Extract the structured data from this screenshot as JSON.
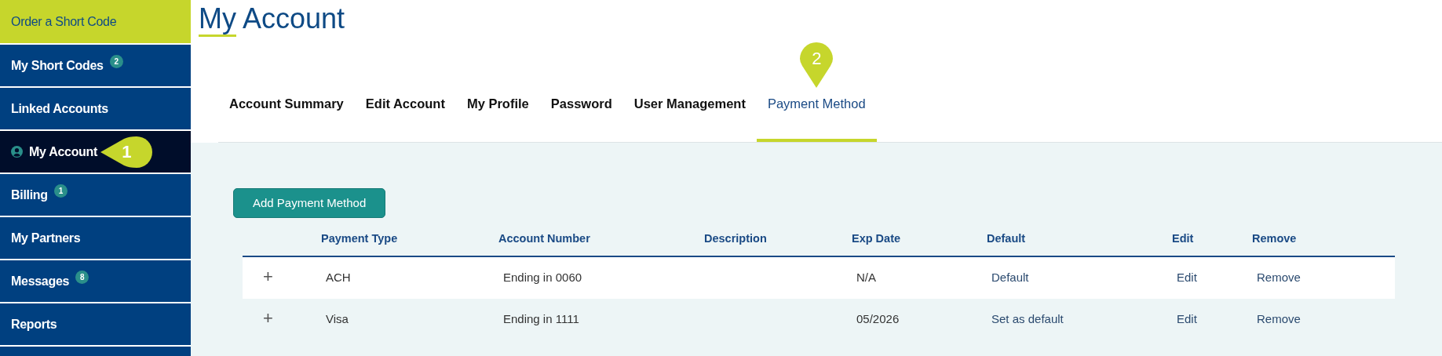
{
  "sidebar": {
    "items": [
      {
        "label": "Order a Short Code",
        "kind": "order",
        "selected": false
      },
      {
        "label": "My Short Codes",
        "badge": "2",
        "kind": "link",
        "selected": false
      },
      {
        "label": "Linked Accounts",
        "kind": "link",
        "selected": false
      },
      {
        "label": "My Account",
        "kind": "account",
        "selected": true,
        "callout": "1"
      },
      {
        "label": "Billing",
        "badge": "1",
        "kind": "link",
        "selected": false
      },
      {
        "label": "My Partners",
        "kind": "link",
        "selected": false
      },
      {
        "label": "Messages",
        "badge": "8",
        "kind": "link",
        "selected": false
      },
      {
        "label": "Reports",
        "kind": "link",
        "selected": false
      }
    ]
  },
  "page_title": "My Account",
  "tabs": [
    {
      "label": "Account Summary",
      "selected": false
    },
    {
      "label": "Edit Account",
      "selected": false
    },
    {
      "label": "My Profile",
      "selected": false
    },
    {
      "label": "Password",
      "selected": false
    },
    {
      "label": "User Management",
      "selected": false
    },
    {
      "label": "Payment Method",
      "selected": true,
      "callout": "2"
    }
  ],
  "add_button": "Add Payment Method",
  "table": {
    "columns": [
      "Payment Type",
      "Account Number",
      "Description",
      "Exp Date",
      "Default",
      "Edit",
      "Remove"
    ],
    "rows": [
      {
        "expand": "+",
        "cells": [
          "ACH",
          "Ending in 0060",
          "",
          "N/A",
          "Default",
          "Edit",
          "Remove"
        ]
      },
      {
        "expand": "+",
        "cells": [
          "Visa",
          "Ending in 1111",
          "",
          "05/2026",
          "Set as default",
          "Edit",
          "Remove"
        ]
      }
    ]
  }
}
